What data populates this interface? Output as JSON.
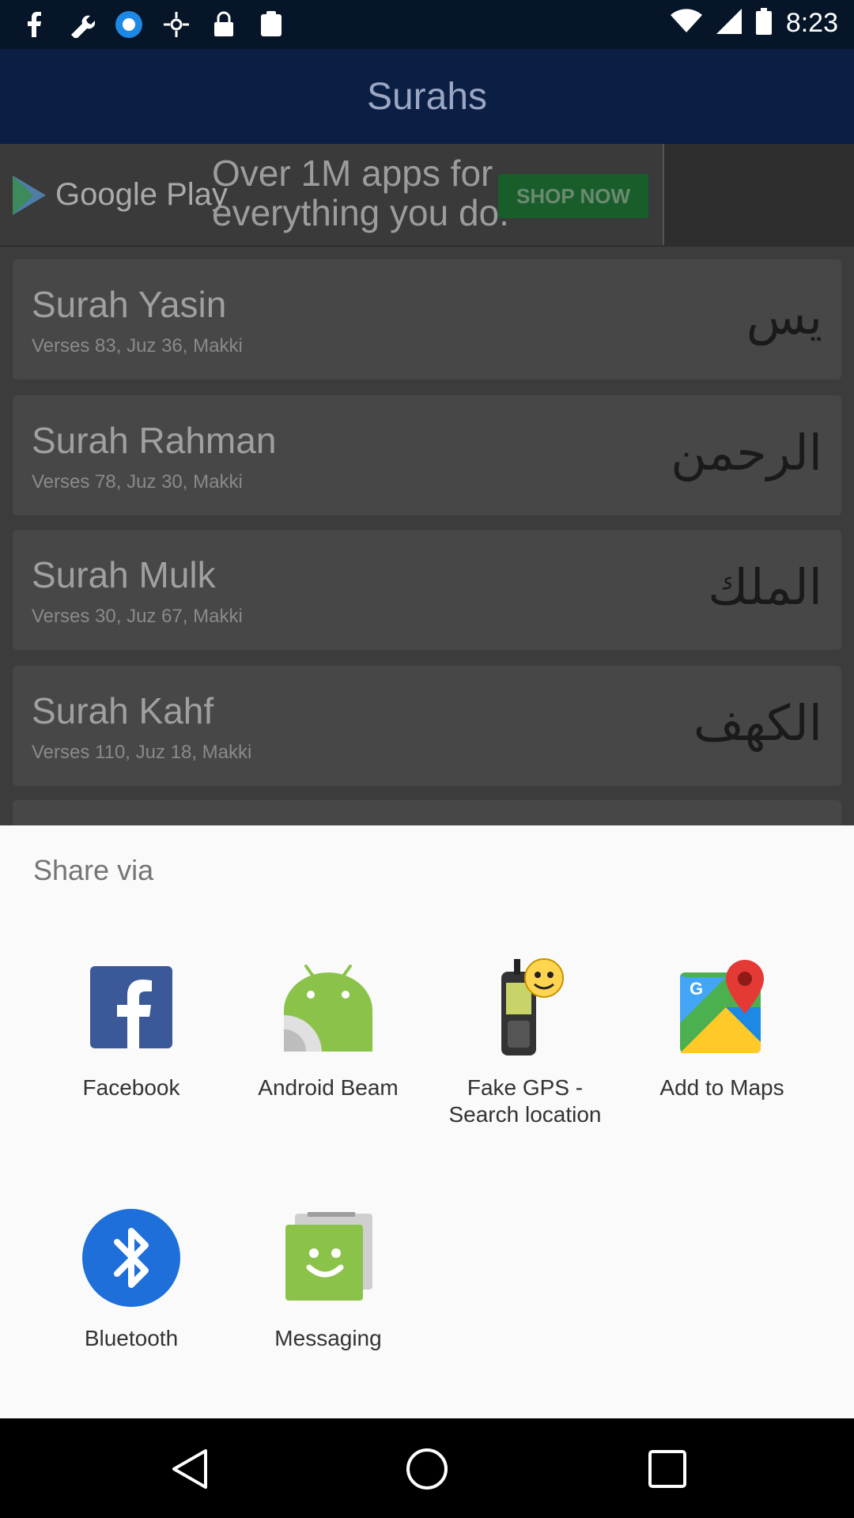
{
  "status_bar": {
    "time": "8:23",
    "left_icons": [
      "facebook-icon",
      "wrench-icon",
      "app-icon",
      "fake-gps-icon",
      "lock-icon",
      "clipboard-icon"
    ],
    "right_icons": [
      "wifi-icon",
      "signal-icon",
      "battery-icon"
    ]
  },
  "app": {
    "title": "Surahs",
    "ad": {
      "brand": "Google Play",
      "text_line1": "Over 1M apps for",
      "text_line2": "everything you do.",
      "cta": "SHOP NOW"
    },
    "surahs": [
      {
        "name": "Surah Yasin",
        "meta": "Verses 83, Juz 36, Makki",
        "arabic": "يس"
      },
      {
        "name": "Surah Rahman",
        "meta": "Verses 78, Juz 30, Makki",
        "arabic": "الرحمن"
      },
      {
        "name": "Surah Mulk",
        "meta": "Verses 30, Juz 67, Makki",
        "arabic": "الملك"
      },
      {
        "name": "Surah Kahf",
        "meta": "Verses 110, Juz 18, Makki",
        "arabic": "الكهف"
      }
    ]
  },
  "share_sheet": {
    "heading": "Share via",
    "apps": [
      {
        "label": "Facebook",
        "icon": "facebook-icon"
      },
      {
        "label": "Android Beam",
        "icon": "android-beam-icon"
      },
      {
        "label": "Fake GPS - Search location",
        "icon": "fake-gps-icon"
      },
      {
        "label": "Add to Maps",
        "icon": "maps-icon"
      },
      {
        "label": "Bluetooth",
        "icon": "bluetooth-icon"
      },
      {
        "label": "Messaging",
        "icon": "messaging-icon"
      }
    ]
  },
  "nav_bar": {
    "buttons": [
      "back-icon",
      "home-icon",
      "recents-icon"
    ]
  }
}
